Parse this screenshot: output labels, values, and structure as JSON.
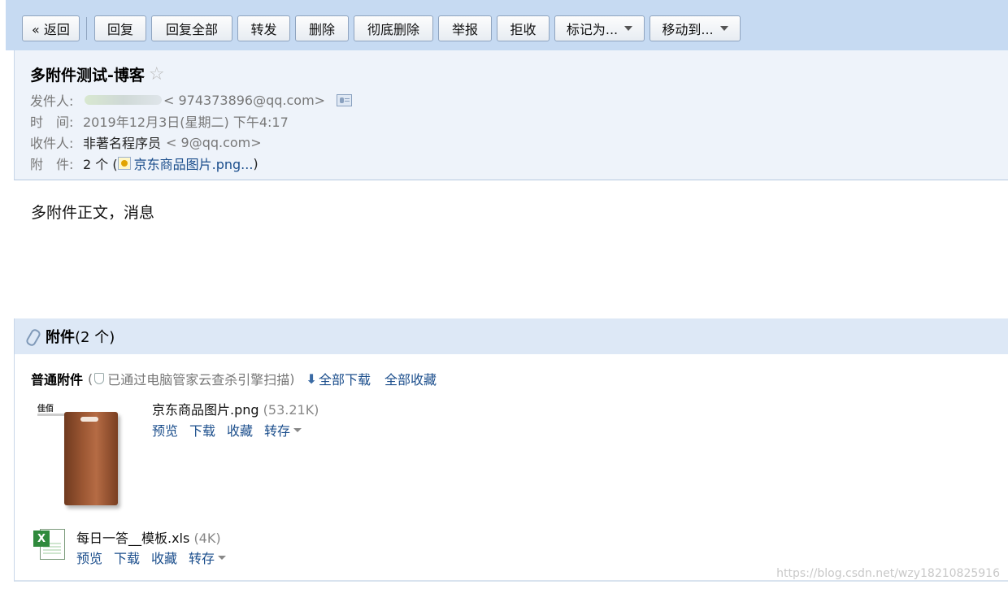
{
  "toolbar": {
    "back": "« 返回",
    "reply": "回复",
    "reply_all": "回复全部",
    "forward": "转发",
    "delete": "删除",
    "delete_forever": "彻底删除",
    "report": "举报",
    "reject": "拒收",
    "mark_as": "标记为...",
    "move_to": "移动到..."
  },
  "header": {
    "subject": "多附件测试-博客",
    "star": "☆",
    "from_label": "发件人:",
    "from_email": "<     974373896@qq.com>",
    "time_label": "时　间:",
    "time_value": "2019年12月3日(星期二) 下午4:17",
    "to_label": "收件人:",
    "to_name": "非著名程序员",
    "to_email": "<          9@qq.com>",
    "attach_label": "附　件:",
    "attach_count": "2 个 (",
    "attach_link": "京东商品图片.png...",
    "attach_close": ")"
  },
  "body": {
    "text": "多附件正文，消息"
  },
  "attachments": {
    "title": "附件",
    "count": "(2 个)",
    "normal_label": "普通附件",
    "scan_open": "(",
    "scan_text": "已通过电脑管家云查杀引擎扫描",
    "scan_close": ")",
    "download_all": "全部下载",
    "favorite_all": "全部收藏",
    "items": [
      {
        "name": "京东商品图片.png",
        "size": "(53.21K)",
        "logo": "佳佰",
        "preview": "预览",
        "download": "下载",
        "favorite": "收藏",
        "save_to": "转存"
      },
      {
        "name": "每日一答__模板.xls",
        "size": "(4K)",
        "icon_letter": "X",
        "preview": "预览",
        "download": "下载",
        "favorite": "收藏",
        "save_to": "转存"
      }
    ]
  },
  "watermark": "https://blog.csdn.net/wzy18210825916"
}
